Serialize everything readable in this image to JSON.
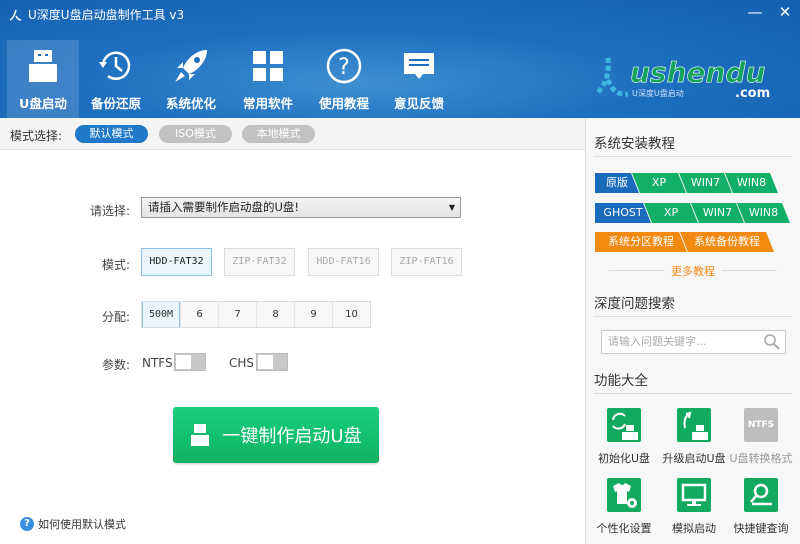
{
  "window": {
    "title": "U深度U盘启动盘制作工具 v3",
    "minimize": "—",
    "close": "✕"
  },
  "nav": [
    {
      "label": "U盘启动",
      "icon": "usb-drive-icon",
      "active": true
    },
    {
      "label": "备份还原",
      "icon": "history-clock-icon"
    },
    {
      "label": "系统优化",
      "icon": "rocket-icon"
    },
    {
      "label": "常用软件",
      "icon": "grid-apps-icon"
    },
    {
      "label": "使用教程",
      "icon": "help-circle-icon"
    },
    {
      "label": "意见反馈",
      "icon": "chat-bubble-icon"
    }
  ],
  "logo": {
    "text": "ushendu",
    "sub": "U深度U盘启动",
    "domain": ".com"
  },
  "mode_bar": {
    "label": "模式选择:",
    "modes": [
      "默认模式",
      "ISO模式",
      "本地模式"
    ],
    "selected": "默认模式"
  },
  "main": {
    "select_label": "请选择:",
    "select_value": "请插入需要制作启动盘的U盘!",
    "mode_label": "模式:",
    "formats": [
      "HDD-FAT32",
      "ZIP-FAT32",
      "HDD-FAT16",
      "ZIP-FAT16"
    ],
    "format_selected": "HDD-FAT32",
    "alloc_label": "分配:",
    "alloc_options": [
      "500M",
      "6",
      "7",
      "8",
      "9",
      "10"
    ],
    "alloc_selected": "500M",
    "param_label": "参数:",
    "ntfs": "NTFS",
    "ntfs_on": false,
    "chs": "CHS",
    "chs_on": false,
    "make_button": "一键制作启动U盘",
    "help_link": "如何使用默认模式"
  },
  "right": {
    "install_title": "系统安装教程",
    "row1": [
      "原版",
      "XP",
      "WIN7",
      "WIN8"
    ],
    "row2": [
      "GHOST",
      "XP",
      "WIN7",
      "WIN8"
    ],
    "row3": [
      "系统分区教程",
      "系统备份教程"
    ],
    "more": "更多教程",
    "search_title": "深度问题搜索",
    "search_placeholder": "请输入问题关键字...",
    "func_title": "功能大全",
    "funcs": [
      {
        "label": "初始化U盘",
        "icon": "init-usb-icon"
      },
      {
        "label": "升级启动U盘",
        "icon": "upgrade-usb-icon"
      },
      {
        "label": "U盘转换格式",
        "icon": "ntfs-convert-icon",
        "badge": "NTFS",
        "disabled": true
      },
      {
        "label": "个性化设置",
        "icon": "personalize-icon"
      },
      {
        "label": "模拟启动",
        "icon": "monitor-icon"
      },
      {
        "label": "快捷键查询",
        "icon": "hotkey-search-icon"
      }
    ]
  },
  "colors": {
    "header": "#1e6fbf",
    "accent": "#1f78c8",
    "green": "#12b066",
    "orange": "#f28a12"
  }
}
